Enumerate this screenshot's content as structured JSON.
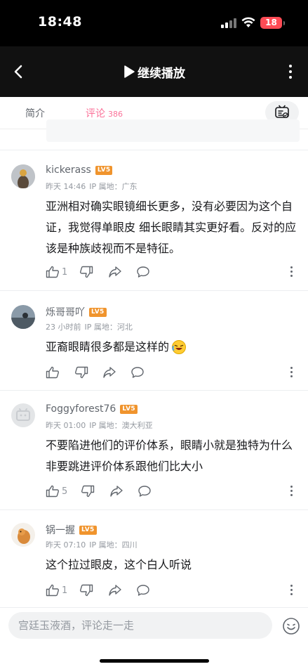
{
  "status_bar": {
    "time": "18:48",
    "battery": "18"
  },
  "nav": {
    "title": "继续播放"
  },
  "tabs": {
    "intro": "简介",
    "comments": "评论",
    "comment_count": "386"
  },
  "comments": [
    {
      "username": "kickerass",
      "level": "LV5",
      "time": "昨天 14:46",
      "location": "IP 属地：广东",
      "text": "亚洲相对确实眼镜细长更多，没有必要因为这个自证，我觉得单眼皮 细长眼睛其实更好看。反对的应该是种族歧视而不是特征。",
      "likes": "1"
    },
    {
      "username": "烁哥哥吖",
      "level": "LV5",
      "time": "23 小时前",
      "location": "IP 属地：河北",
      "text": "亚裔眼睛很多都是这样的",
      "likes": ""
    },
    {
      "username": "Foggyforest76",
      "level": "LV5",
      "time": "昨天 01:00",
      "location": "IP 属地：澳大利亚",
      "text": "不要陷进他们的评价体系，眼睛小就是独特为什么非要跳进评价体系跟他们比大小",
      "likes": "5"
    },
    {
      "username": "锅一握",
      "level": "LV5",
      "time": "昨天 07:10",
      "location": "IP 属地：四川",
      "text": "这个拉过眼皮，这个白人听说",
      "likes": "1"
    }
  ],
  "input": {
    "placeholder": "宫廷玉液酒，评论走一走"
  }
}
